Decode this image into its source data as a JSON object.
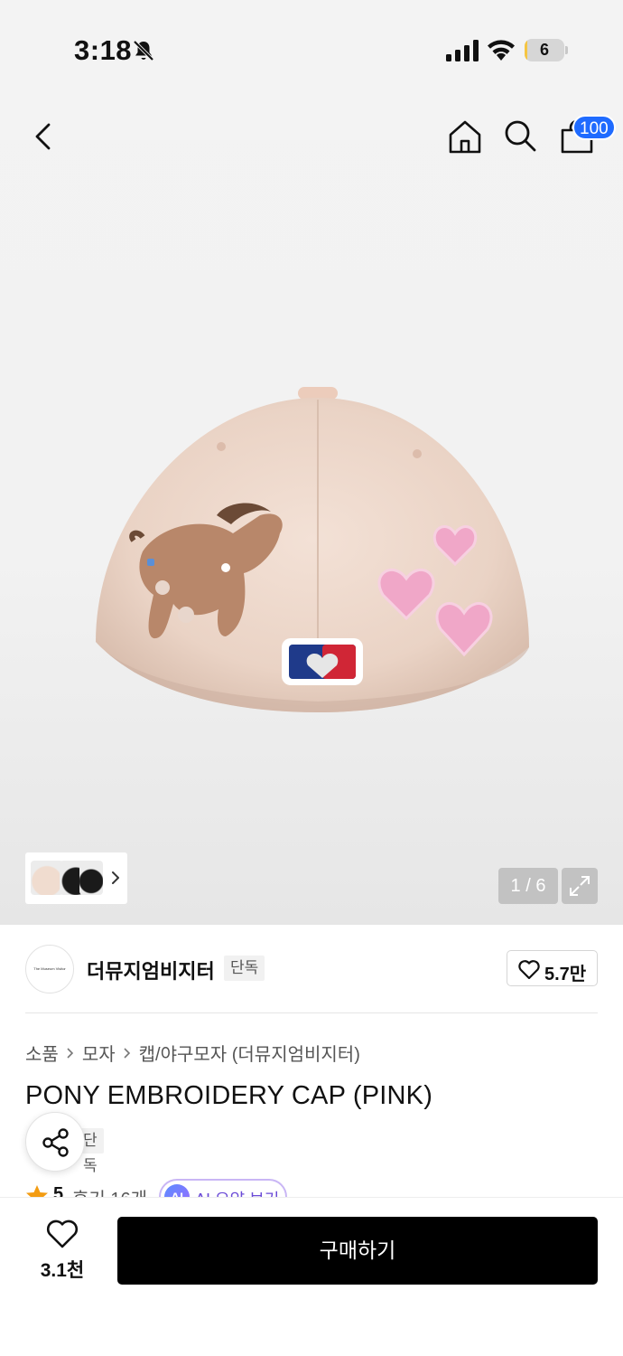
{
  "status_bar": {
    "time": "3:18",
    "battery_level": "6",
    "battery_fraction": 0.06
  },
  "nav": {
    "cart_badge": "100"
  },
  "gallery": {
    "page_counter": "1 / 6"
  },
  "brand": {
    "name": "더뮤지엄비지터",
    "logo_text": "The Museum Visitor",
    "exclusive_tag": "단독",
    "like_count": "5.7만"
  },
  "breadcrumb": {
    "items": [
      "소품",
      "모자",
      "캡/야구모자 (더뮤지엄비지터)"
    ]
  },
  "product": {
    "title": "PONY EMBROIDERY CAP (PINK)",
    "exclusive_tag": "단독",
    "rating": "5",
    "review_count": "후기 16개",
    "ai_badge": "AI",
    "ai_summary_label": "AI 요약 보기"
  },
  "bottom_bar": {
    "wish_count": "3.1천",
    "buy_label": "구매하기"
  },
  "colors": {
    "accent_blue": "#1f6bff",
    "buy_button": "#000000",
    "star": "#f39c12",
    "ai_purple": "#6a4ad6"
  },
  "icons": [
    "bell-slash-icon",
    "signal-icon",
    "wifi-icon",
    "battery-icon",
    "back-arrow-icon",
    "home-icon",
    "search-icon",
    "shopping-bag-icon",
    "chevron-right-icon",
    "fullscreen-icon",
    "heart-icon",
    "share-icon",
    "star-icon"
  ]
}
